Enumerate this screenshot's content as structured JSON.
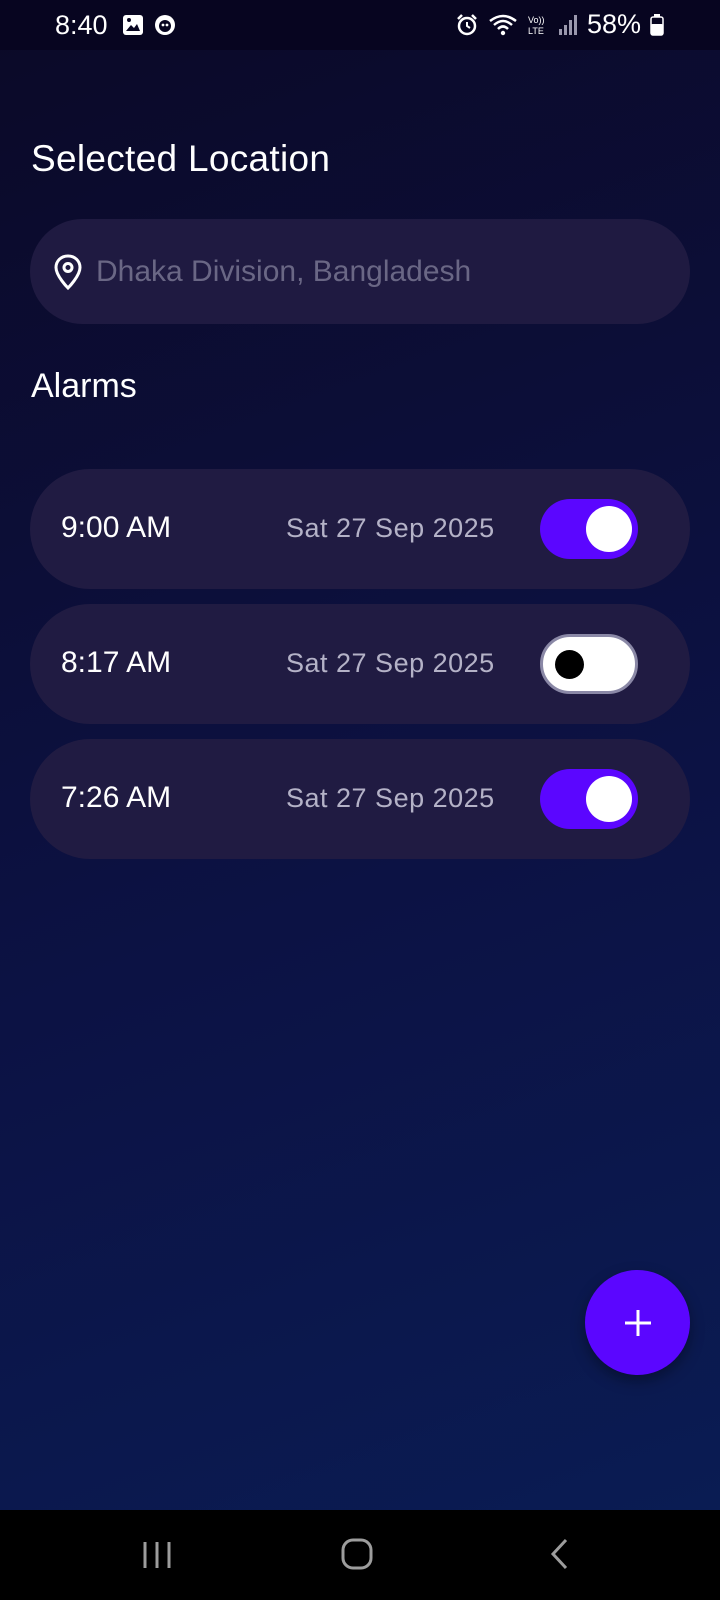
{
  "status_bar": {
    "time": "8:40",
    "battery": "58%",
    "left_icons": [
      "image-icon",
      "app-notification-icon"
    ],
    "right_icons": [
      "alarm-icon",
      "wifi-icon",
      "volte-icon",
      "signal-icon",
      "battery-icon"
    ],
    "volte_label": "Vo))",
    "lte_label": "LTE"
  },
  "header": {
    "title": "Selected Location"
  },
  "location": {
    "placeholder": "Dhaka Division, Bangladesh",
    "icon": "location-pin-icon"
  },
  "alarms": {
    "title": "Alarms",
    "items": [
      {
        "time": "9:00 AM",
        "date": "Sat 27 Sep 2025",
        "enabled": true
      },
      {
        "time": "8:17 AM",
        "date": "Sat 27 Sep 2025",
        "enabled": false
      },
      {
        "time": "7:26 AM",
        "date": "Sat 27 Sep 2025",
        "enabled": true
      }
    ]
  },
  "fab": {
    "icon": "plus-icon"
  },
  "nav": [
    "recents-icon",
    "home-icon",
    "back-icon"
  ],
  "colors": {
    "accent": "#5b06ff",
    "card": "#201b42",
    "background_top": "#0b0927",
    "background_bottom": "#0a1d55"
  }
}
